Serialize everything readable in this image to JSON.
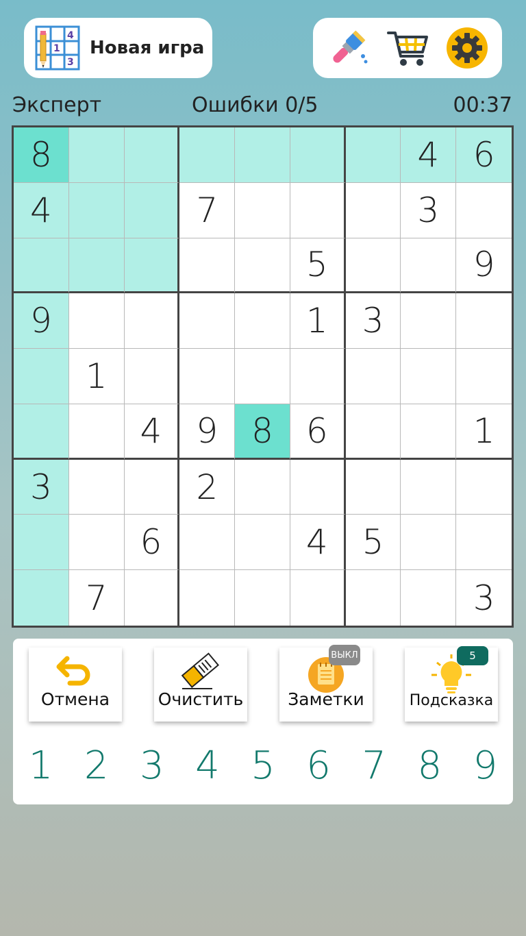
{
  "header": {
    "new_game_label": "Новая игра",
    "icon_digits": [
      "4",
      "1",
      "3"
    ]
  },
  "status": {
    "difficulty": "Эксперт",
    "mistakes": "Ошибки 0/5",
    "timer": "00:37"
  },
  "board": {
    "cells": [
      [
        "8",
        "",
        "",
        "",
        "",
        "",
        "",
        "4",
        "6"
      ],
      [
        "4",
        "",
        "",
        "7",
        "",
        "",
        "",
        "3",
        ""
      ],
      [
        "",
        "",
        "",
        "",
        "",
        "5",
        "",
        "",
        "9"
      ],
      [
        "9",
        "",
        "",
        "",
        "",
        "1",
        "3",
        "",
        ""
      ],
      [
        "",
        "1",
        "",
        "",
        "",
        "",
        "",
        "",
        ""
      ],
      [
        "",
        "",
        "4",
        "9",
        "8",
        "6",
        "",
        "",
        "1"
      ],
      [
        "3",
        "",
        "",
        "2",
        "",
        "",
        "",
        "",
        ""
      ],
      [
        "",
        "",
        "6",
        "",
        "",
        "4",
        "5",
        "",
        ""
      ],
      [
        "",
        "7",
        "",
        "",
        "",
        "",
        "",
        "",
        "3"
      ]
    ],
    "highlighted": [
      [
        0,
        1
      ],
      [
        0,
        2
      ],
      [
        0,
        3
      ],
      [
        0,
        4
      ],
      [
        0,
        5
      ],
      [
        0,
        6
      ],
      [
        0,
        7
      ],
      [
        0,
        8
      ],
      [
        1,
        0
      ],
      [
        1,
        1
      ],
      [
        1,
        2
      ],
      [
        2,
        0
      ],
      [
        2,
        1
      ],
      [
        2,
        2
      ],
      [
        3,
        0
      ],
      [
        4,
        0
      ],
      [
        5,
        0
      ],
      [
        6,
        0
      ],
      [
        7,
        0
      ],
      [
        8,
        0
      ]
    ],
    "same_value": [
      [
        0,
        0
      ],
      [
        5,
        4
      ]
    ]
  },
  "tools": {
    "undo_label": "Отмена",
    "erase_label": "Очистить",
    "notes_label": "Заметки",
    "notes_badge": "ВЫКЛ",
    "hint_label": "Подсказка",
    "hint_badge": "5"
  },
  "numpad": [
    "1",
    "2",
    "3",
    "4",
    "5",
    "6",
    "7",
    "8",
    "9"
  ],
  "colors": {
    "highlight": "#b1efe6",
    "selected": "#6ce0cf",
    "numpad": "#12796c",
    "orange": "#f5a623"
  },
  "icons": {
    "new_game": "sudoku-grid-icon",
    "theme": "paint-brush-icon",
    "shop": "shopping-cart-icon",
    "settings": "gear-icon",
    "undo": "undo-arrow-icon",
    "erase": "eraser-icon",
    "notes": "notepad-icon",
    "hint": "lightbulb-icon"
  }
}
